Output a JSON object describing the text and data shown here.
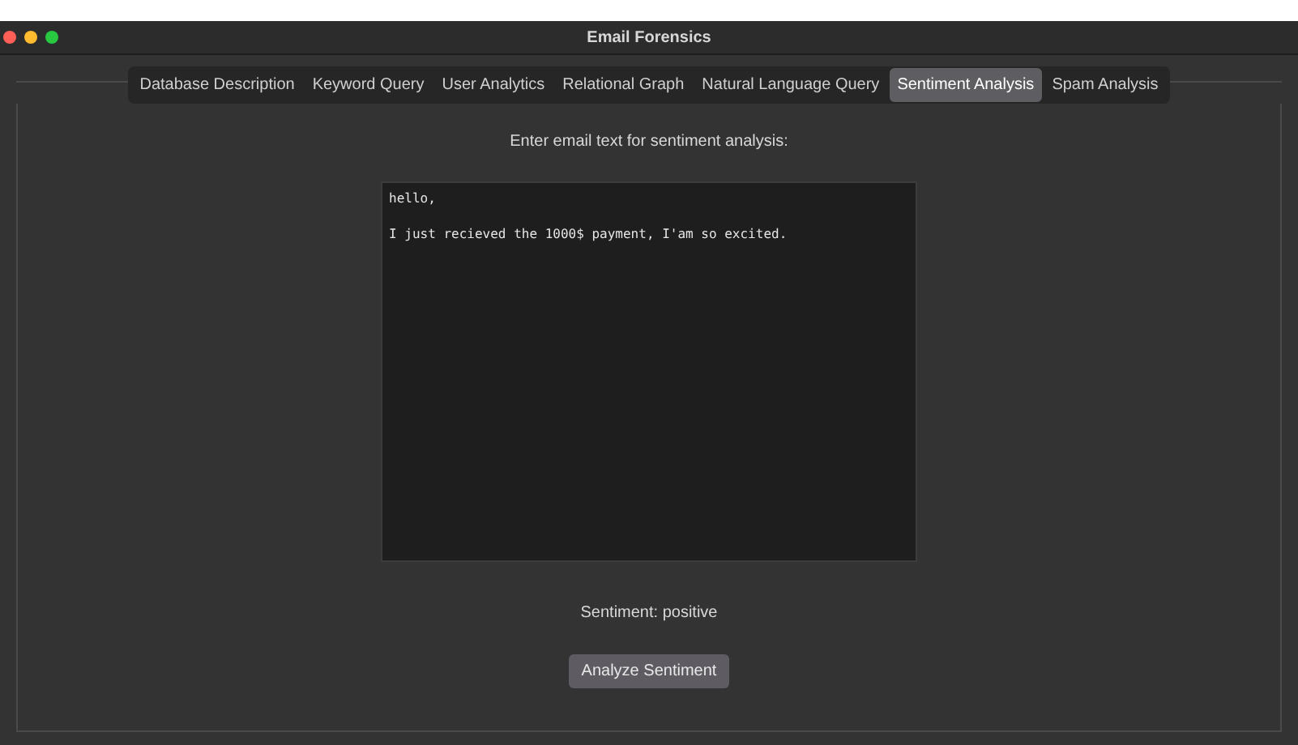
{
  "window": {
    "title": "Email Forensics"
  },
  "tabs": [
    {
      "label": "Database Description",
      "selected": false
    },
    {
      "label": "Keyword Query",
      "selected": false
    },
    {
      "label": "User Analytics",
      "selected": false
    },
    {
      "label": "Relational Graph",
      "selected": false
    },
    {
      "label": "Natural Language Query",
      "selected": false
    },
    {
      "label": "Sentiment Analysis",
      "selected": true
    },
    {
      "label": "Spam Analysis",
      "selected": false
    }
  ],
  "prompt": "Enter email text for sentiment analysis:",
  "email_text": {
    "value": "hello,\n\nI just recieved the 1000$ payment, I'am so excited."
  },
  "result": "Sentiment: positive",
  "buttons": [
    "Analyze Sentiment"
  ]
}
